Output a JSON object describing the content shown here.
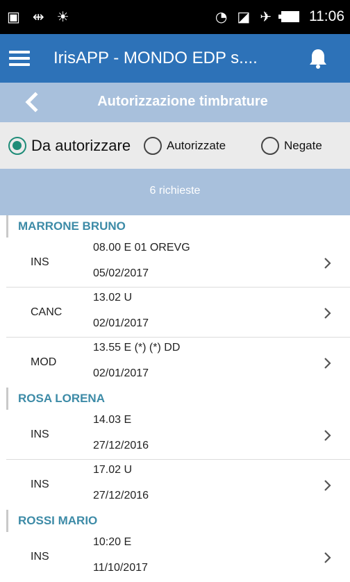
{
  "status_bar": {
    "time": "11:06",
    "icons": [
      "image-notification-icon",
      "usb-icon",
      "android-debug-icon",
      "wifi-icon",
      "no-sim-icon",
      "airplane-mode-icon",
      "battery-icon"
    ]
  },
  "app_bar": {
    "title": "IrisAPP - MONDO EDP s....",
    "menu_icon": "hamburger-menu-icon",
    "notification_icon": "bell-icon",
    "color": "#2d72b8"
  },
  "page_header": {
    "title": "Autorizzazione timbrature",
    "back_icon": "chevron-left-icon"
  },
  "filters": {
    "options": [
      {
        "label": "Da autorizzare",
        "selected": true
      },
      {
        "label": "Autorizzate",
        "selected": false
      },
      {
        "label": "Negate",
        "selected": false
      }
    ],
    "accent": "#1e8c78"
  },
  "summary": {
    "count_label": "6 richieste"
  },
  "groups": [
    {
      "name": "MARRONE BRUNO",
      "items": [
        {
          "type": "INS",
          "detail": "08.00 E 01 OREVG",
          "date": "05/02/2017"
        },
        {
          "type": "CANC",
          "detail": "13.02 U",
          "date": "02/01/2017"
        },
        {
          "type": "MOD",
          "detail": "13.55 E (*)  (*) DD",
          "date": "02/01/2017"
        }
      ]
    },
    {
      "name": "ROSA LORENA",
      "items": [
        {
          "type": "INS",
          "detail": "14.03 E",
          "date": "27/12/2016"
        },
        {
          "type": "INS",
          "detail": "17.02 U",
          "date": "27/12/2016"
        }
      ]
    },
    {
      "name": "ROSSI MARIO",
      "items": [
        {
          "type": "INS",
          "detail": "10:20 E",
          "date": "11/10/2017"
        }
      ]
    }
  ]
}
